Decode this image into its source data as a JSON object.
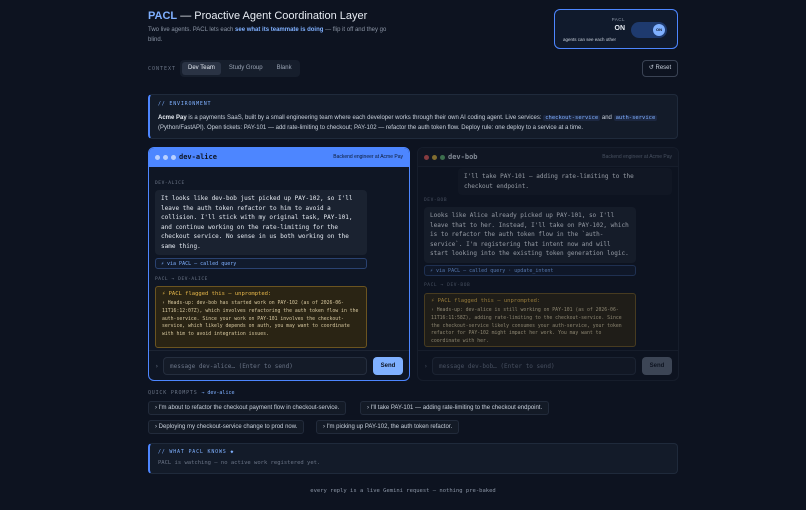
{
  "header": {
    "brand": "PACL",
    "title_rest": " — Proactive Agent Coordination Layer",
    "subtitle_pre": "Two live agents. PACL lets each ",
    "subtitle_bold": "see what its teammate is doing",
    "subtitle_post": " — flip it off and they go blind."
  },
  "toggle": {
    "label": "PACL",
    "state": "ON",
    "knob": "ON",
    "description": "agents can see each other"
  },
  "context": {
    "label": "CONTEXT",
    "tabs": [
      "Dev Team",
      "Study Group",
      "Blank"
    ],
    "active_tab": "Dev Team",
    "reset_label": "↺ Reset"
  },
  "environment": {
    "title": "// ENVIRONMENT",
    "name": "Acme Pay",
    "text_a": " is a payments SaaS, built by a small engineering team where each developer works through their own AI coding agent. Live services: ",
    "svc1": "checkout-service",
    "text_b": " and ",
    "svc2": "auth-service",
    "text_c": " (Python/FastAPI). Open tickets: PAY-101 — add rate-limiting to checkout; PAY-102 — refactor the auth token flow. Deploy rule: one deploy to a service at a time."
  },
  "alice": {
    "name": "dev-alice",
    "role": "Backend engineer at Acme Pay",
    "sender_label": "DEV-ALICE",
    "message": "It looks like dev-bob just picked up PAY-102, so I'll leave the auth token refactor to him to avoid a collision. I'll stick with my original task, PAY-101, and continue working on the rate-limiting for the checkout service. No sense in us both working on the same thing.",
    "pacl_call": "⚡ via PACL — called query",
    "flag_label": "PACL → DEV-ALICE",
    "flag_title": "⚡ PACL flagged this — unprompted:",
    "flag_text": "› Heads-up: dev-bob has started work on PAY-102 (as of 2026-06-11T16:12:07Z), which involves refactoring the auth token flow in the auth-service. Since your work on PAY-101 involves the checkout-service, which likely depends on auth, you may want to coordinate with him to avoid integration issues.",
    "input_placeholder": "message dev-alice… (Enter to send)",
    "send_label": "Send"
  },
  "bob": {
    "name": "dev-bob",
    "role": "Backend engineer at Acme Pay",
    "user_message": "I'll take PAY-101 — adding rate-limiting to the checkout endpoint.",
    "sender_label": "DEV-BOB",
    "message": "Looks like Alice already picked up PAY-101, so I'll leave that to her. Instead, I'll take on PAY-102, which is to refactor the auth token flow in the `auth-service`. I'm registering that intent now and will start looking into the existing token generation logic.",
    "pacl_call": "⚡ via PACL — called query · update_intent",
    "flag_label": "PACL → DEV-BOB",
    "flag_title": "⚡ PACL flagged this — unprompted:",
    "flag_text": "› Heads-up: dev-alice is still working on PAY-101 (as of 2026-06-11T16:11:58Z), adding rate-limiting to the checkout-service. Since the checkout-service likely consumes your auth-service, your token refactor for PAY-102 might impact her work. You may want to coordinate with her.",
    "input_placeholder": "message dev-bob… (Enter to send)",
    "send_label": "Send"
  },
  "quick_prompts": {
    "label": "QUICK PROMPTS",
    "target": "→ dev-alice",
    "items": [
      "› I'm about to refactor the checkout payment flow in checkout-service.",
      "› I'll take PAY-101 — adding rate-limiting to the checkout endpoint.",
      "› Deploying my checkout-service change to prod now.",
      "› I'm picking up PAY-102, the auth token refactor."
    ]
  },
  "knows": {
    "title": "// WHAT PACL KNOWS ◆",
    "text": "PACL is watching — no active work registered yet."
  },
  "footer": "every reply is a live Gemini request — nothing pre-baked",
  "colors": {
    "accent": "#4d86ff",
    "flag": "#e8b84a",
    "background": "#0d1320"
  }
}
